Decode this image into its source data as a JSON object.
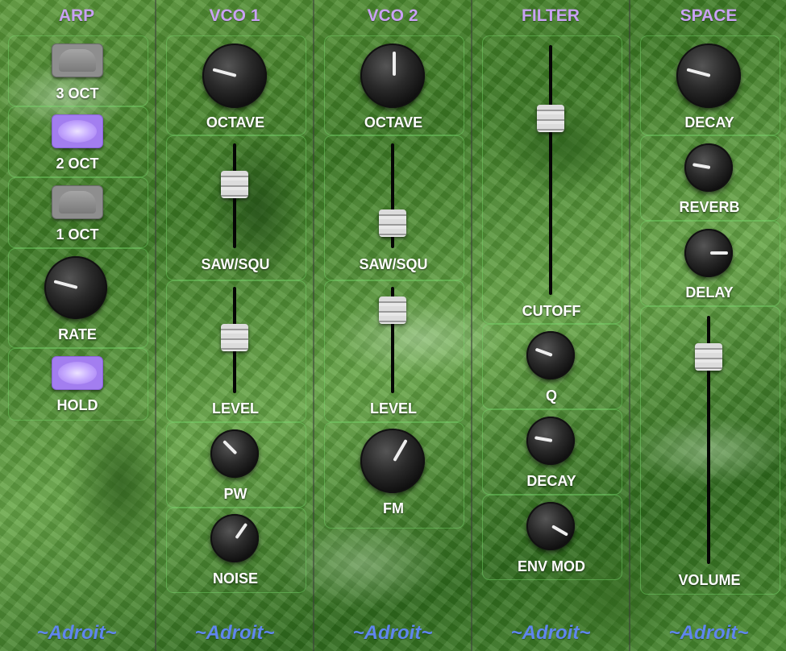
{
  "sections": {
    "arp": {
      "title": "ARP"
    },
    "vco1": {
      "title": "VCO 1"
    },
    "vco2": {
      "title": "VCO 2"
    },
    "filter": {
      "title": "FILTER"
    },
    "space": {
      "title": "SPACE"
    }
  },
  "brand": "~Adroit~",
  "arp": {
    "oct3": {
      "label": "3 OCT",
      "on": false
    },
    "oct2": {
      "label": "2 OCT",
      "on": true
    },
    "oct1": {
      "label": "1 OCT",
      "on": false
    },
    "rate": {
      "label": "RATE"
    },
    "hold": {
      "label": "HOLD",
      "on": true
    }
  },
  "vco1": {
    "octave": {
      "label": "OCTAVE"
    },
    "saw_squ": {
      "label": "SAW/SQU"
    },
    "level": {
      "label": "LEVEL"
    },
    "pw": {
      "label": "PW"
    },
    "noise": {
      "label": "NOISE"
    }
  },
  "vco2": {
    "octave": {
      "label": "OCTAVE"
    },
    "saw_squ": {
      "label": "SAW/SQU"
    },
    "level": {
      "label": "LEVEL"
    },
    "fm": {
      "label": "FM"
    }
  },
  "filter": {
    "cutoff": {
      "label": "CUTOFF"
    },
    "q": {
      "label": "Q"
    },
    "decay": {
      "label": "DECAY"
    },
    "env_mod": {
      "label": "ENV MOD"
    }
  },
  "space": {
    "decay": {
      "label": "DECAY"
    },
    "reverb": {
      "label": "REVERB"
    },
    "delay": {
      "label": "DELAY"
    },
    "volume": {
      "label": "VOLUME"
    }
  },
  "colors": {
    "title": "#c9a2f3",
    "brand": "#5f86ee",
    "button_on": "#a37ef0",
    "button_off": "#8e8e8e"
  }
}
